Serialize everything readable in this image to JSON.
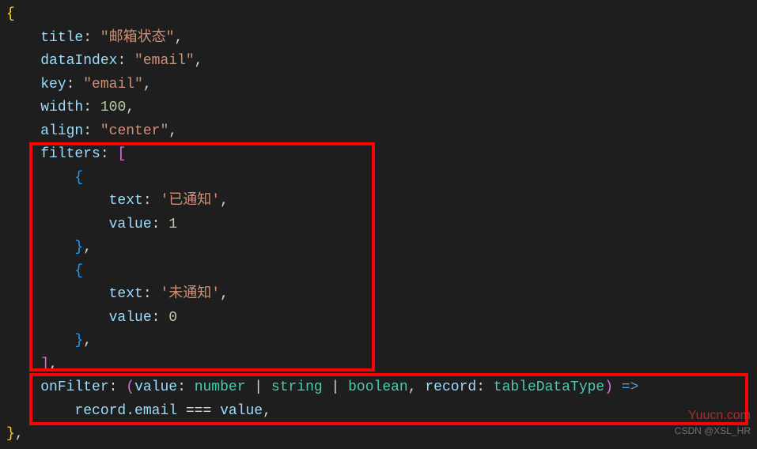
{
  "code": {
    "open_brace": "{",
    "title_key": "title",
    "title_val": "\"邮箱状态\"",
    "dataIndex_key": "dataIndex",
    "dataIndex_val": "\"email\"",
    "key_key": "key",
    "key_val": "\"email\"",
    "width_key": "width",
    "width_val": "100",
    "align_key": "align",
    "align_val": "\"center\"",
    "filters_key": "filters",
    "filters_open": "[",
    "f1_text_key": "text",
    "f1_text_val": "'已通知'",
    "f1_value_key": "value",
    "f1_value_val": "1",
    "f2_text_key": "text",
    "f2_text_val": "'未通知'",
    "f2_value_key": "value",
    "f2_value_val": "0",
    "filters_close": "]",
    "onFilter_key": "onFilter",
    "param1_name": "value",
    "param1_type1": "number",
    "param1_type2": "string",
    "param1_type3": "boolean",
    "param2_name": "record",
    "param2_type": "tableDataType",
    "arrow": "=>",
    "body_record": "record",
    "body_email": ".email",
    "body_eq": " === ",
    "body_value": "value",
    "close_brace": "}",
    "comma": ",",
    "colon": ": ",
    "obj_open": "{",
    "obj_close": "}",
    "paren_open": "(",
    "paren_close": ")",
    "pipe": " | "
  },
  "watermark1": "Yuucn.com",
  "watermark2": "CSDN @XSL_HR"
}
